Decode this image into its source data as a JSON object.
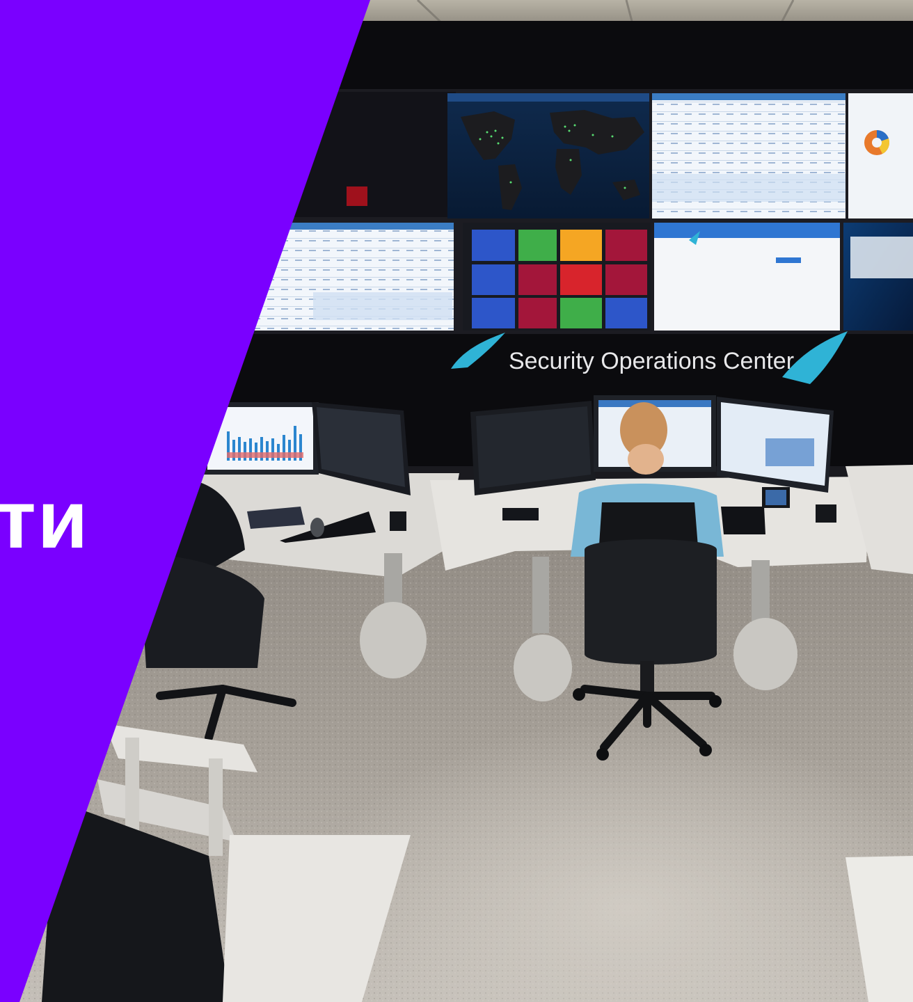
{
  "hero": {
    "heading_fragment": "ти",
    "panel_color": "#7a00ff"
  },
  "photo": {
    "wall_sign": "Security Operations Center",
    "accent_color": "#2fb3d6",
    "tile_colors": [
      "#d8242c",
      "#3fae49",
      "#f5a623",
      "#2d56c9",
      "#a3163a",
      "#1b9ad6"
    ]
  }
}
